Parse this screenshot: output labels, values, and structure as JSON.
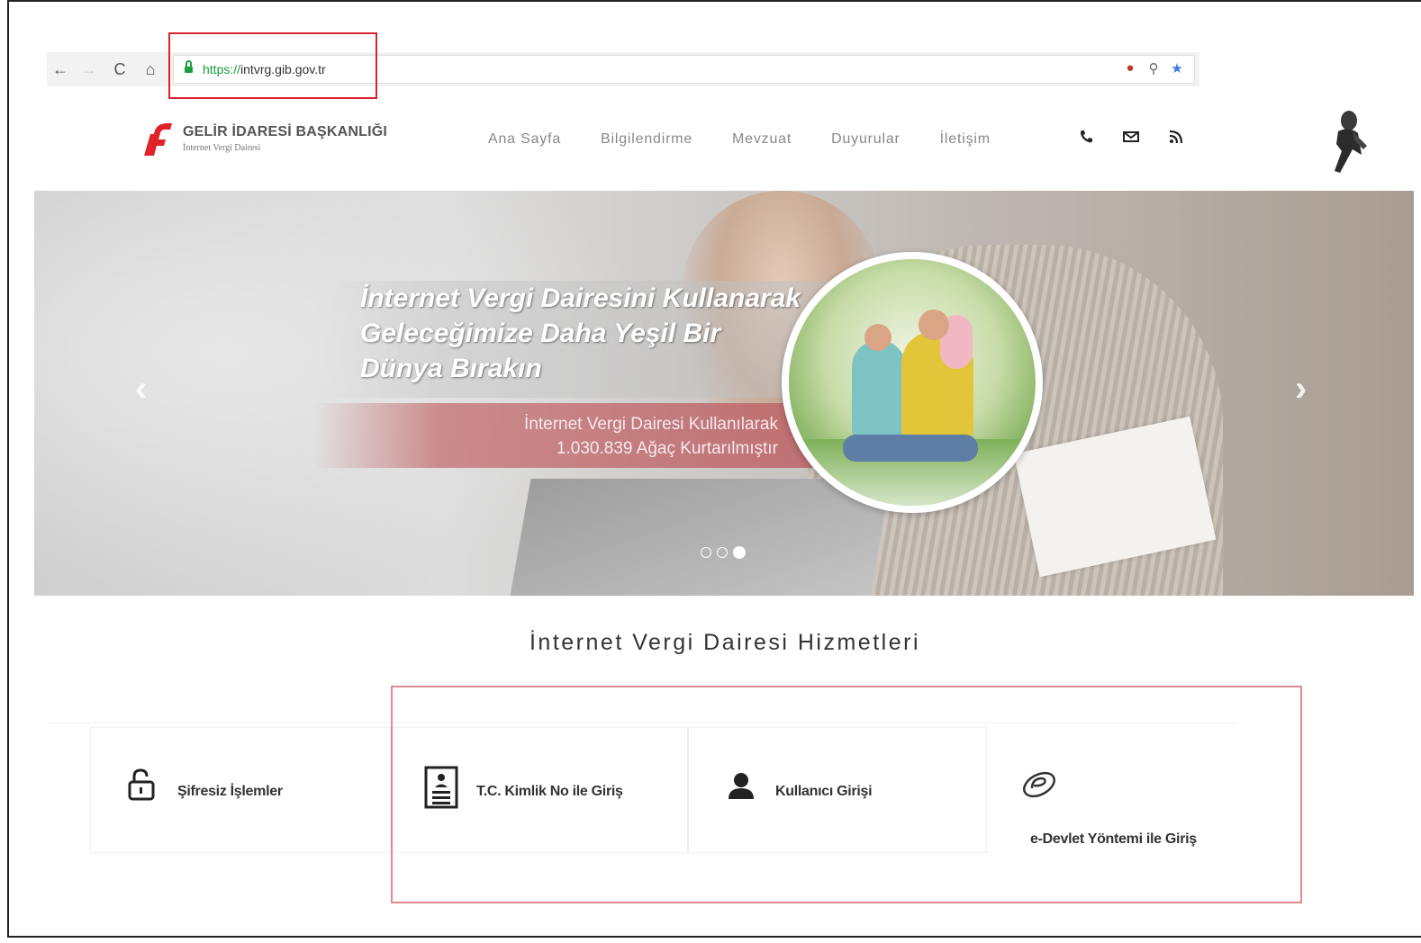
{
  "browser": {
    "url_scheme": "https://",
    "url_host": "intvrg.gib.gov.tr"
  },
  "header": {
    "logo_title": "GELİR İDARESİ BAŞKANLIĞI",
    "logo_subtitle": "İnternet Vergi Dairesi",
    "menu": [
      "Ana Sayfa",
      "Bilgilendirme",
      "Mevzuat",
      "Duyurular",
      "İletişim"
    ],
    "icons": [
      "phone-icon",
      "mail-icon",
      "rss-icon"
    ]
  },
  "hero": {
    "headline_line1": "İnternet Vergi Dairesini Kullanarak",
    "headline_line2": "Geleceğimize Daha Yeşil Bir",
    "headline_line3": "Dünya Bırakın",
    "sub_line1": "İnternet Vergi Dairesi Kullanılarak",
    "sub_line2": "1.030.839 Ağaç Kurtarılmıştır",
    "slide_count": 3,
    "active_slide": 3
  },
  "services": {
    "title": "İnternet Vergi Dairesi Hizmetleri",
    "items": [
      {
        "label": "Şifresiz İşlemler",
        "icon": "unlock-icon"
      },
      {
        "label": "T.C. Kimlik No ile Giriş",
        "icon": "id-card-icon"
      },
      {
        "label": "Kullanıcı Girişi",
        "icon": "user-icon"
      },
      {
        "label": "e-Devlet Yöntemi ile Giriş",
        "icon": "e-devlet-icon"
      }
    ]
  },
  "colors": {
    "highlight": "#d9232e",
    "brand_red": "#e02228",
    "secure_green": "#1a9e3c"
  }
}
